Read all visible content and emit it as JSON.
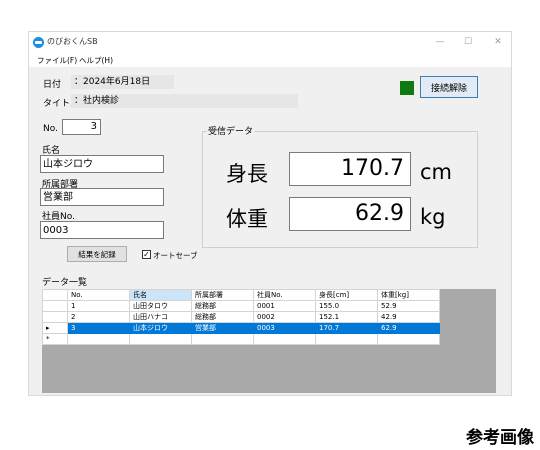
{
  "window": {
    "title": "のびおくんSB",
    "controls": {
      "minimize": "—",
      "maximize": "☐",
      "close": "✕"
    }
  },
  "menu": [
    {
      "label": "ファイル(F)"
    },
    {
      "label": "ヘルプ(H)"
    }
  ],
  "header": {
    "date_label": "日付",
    "date_value": "：2024年6月18日",
    "title_label": "タイトル",
    "title_value": "：社内検診",
    "status_color": "#0f7a0f",
    "disconnect_button": "接続解除"
  },
  "form": {
    "no_label": "No.",
    "no_value": "3",
    "name_label": "氏名",
    "name_value": "山本ジロウ",
    "dept_label": "所属部署",
    "dept_value": "営業部",
    "employee_label": "社員No.",
    "employee_value": "0003",
    "record_button": "結果を記録",
    "autosave_label": "オートセーブ",
    "autosave_checked": true
  },
  "received": {
    "title": "受信データ",
    "height_label": "身長",
    "height_value": "170.7",
    "height_unit": "cm",
    "weight_label": "体重",
    "weight_value": "62.9",
    "weight_unit": "kg"
  },
  "list": {
    "title": "データ一覧",
    "columns": [
      "No.",
      "氏名",
      "所属部署",
      "社員No.",
      "身長[cm]",
      "体重[kg]"
    ],
    "rows": [
      [
        "1",
        "山田タロウ",
        "総務部",
        "0001",
        "155.0",
        "52.9"
      ],
      [
        "2",
        "山田ハナコ",
        "総務部",
        "0002",
        "152.1",
        "42.9"
      ],
      [
        "3",
        "山本ジロウ",
        "営業部",
        "0003",
        "170.7",
        "62.9"
      ]
    ],
    "selected_row_marker": "▸",
    "new_row_marker": "*"
  },
  "reference_label": "参考画像"
}
